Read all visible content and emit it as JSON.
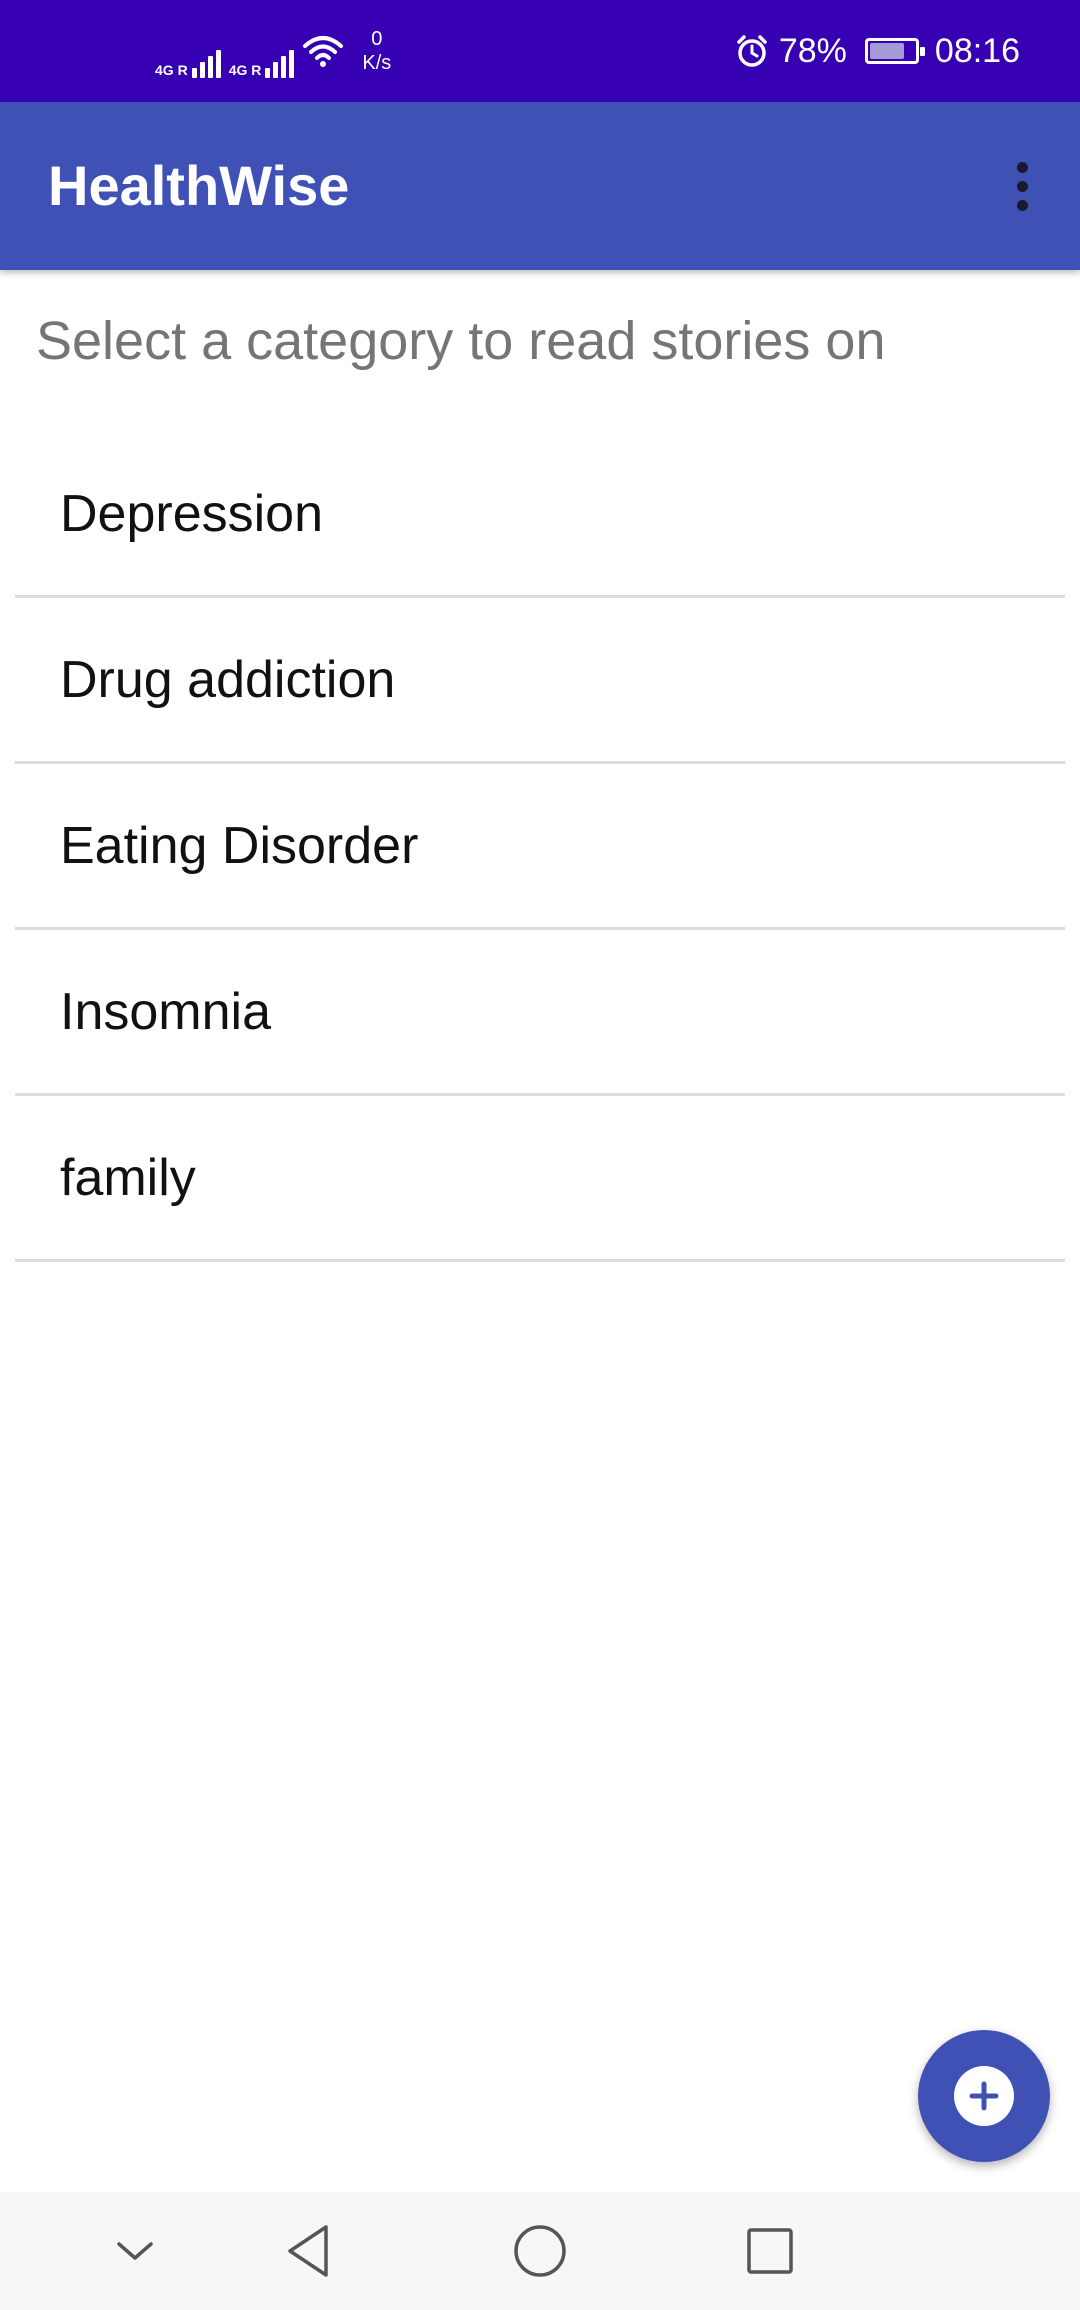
{
  "status_bar": {
    "network_1": "4G R",
    "network_2": "4G R",
    "speed_value": "0",
    "speed_unit": "K/s",
    "battery_percent": "78%",
    "battery_level": 0.78,
    "time": "08:16",
    "icons": [
      "signal-icon",
      "signal-icon",
      "wifi-icon",
      "alarm-icon",
      "battery-icon"
    ]
  },
  "app_bar": {
    "title": "HealthWise",
    "menu_icon": "more-vert-icon"
  },
  "main": {
    "subtitle": "Select a category to read stories on",
    "categories": [
      {
        "label": "Depression"
      },
      {
        "label": "Drug addiction"
      },
      {
        "label": "Eating Disorder"
      },
      {
        "label": "Insomnia"
      },
      {
        "label": "family"
      }
    ]
  },
  "fab": {
    "icon": "add-circle-icon"
  },
  "nav_bar": {
    "buttons": [
      "collapse-icon",
      "back-icon",
      "home-icon",
      "recents-icon"
    ]
  },
  "colors": {
    "status_bar": "#3700b3",
    "app_bar": "#3f51b5",
    "fab": "#3f51b5",
    "subtitle": "#757575",
    "divider": "#dcdcdc"
  }
}
